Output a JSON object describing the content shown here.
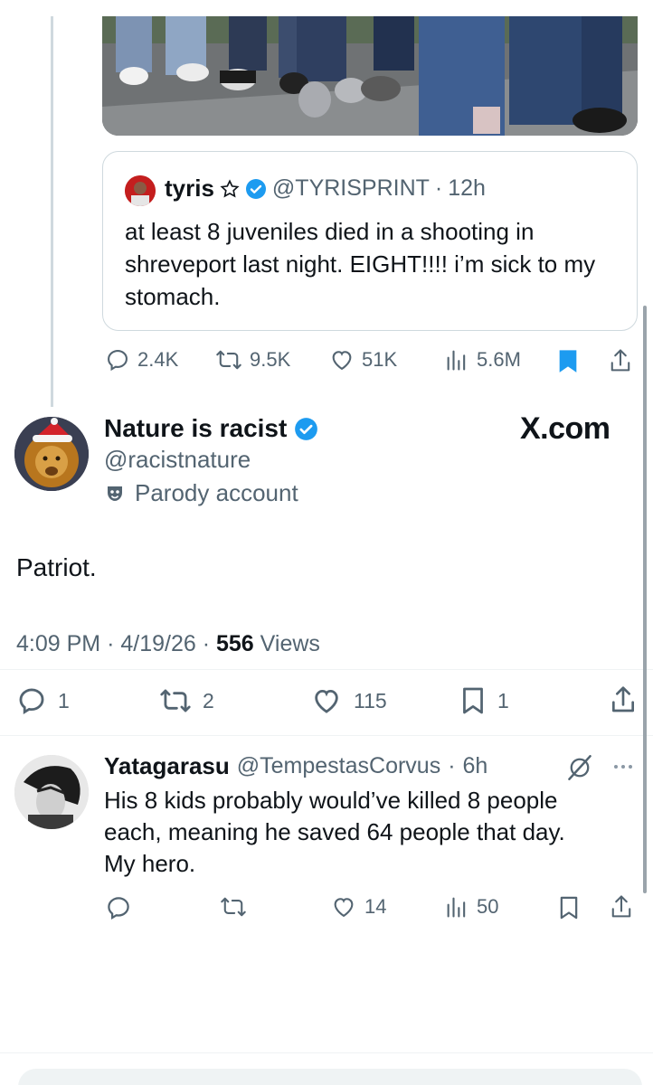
{
  "quoted": {
    "name": "tyris",
    "handle": "@TYRISPRINT",
    "time": "12h",
    "text": "at least 8 juveniles died in a shooting in shreveport last night. EIGHT!!!! i’m sick to my stomach."
  },
  "parent_actions": {
    "replies": "2.4K",
    "reposts": "9.5K",
    "likes": "51K",
    "views": "5.6M"
  },
  "main": {
    "name": "Nature is racist",
    "handle": "@racistnature",
    "label": "Parody account",
    "watermark": "X.com",
    "text": "Patriot.",
    "time": "4:09 PM",
    "date": "4/19/26",
    "views_count": "556",
    "views_label": "Views",
    "replies": "1",
    "reposts": "2",
    "likes": "115",
    "bookmarks": "1"
  },
  "reply": {
    "name": "Yatagarasu",
    "handle": "@TempestasCorvus",
    "time": "6h",
    "text_line1": "His 8 kids probably would’ve killed 8 people",
    "text_line2": "each, meaning he saved 64 people that day.",
    "text_line3": "My hero.",
    "likes": "14",
    "views": "50"
  },
  "colors": {
    "verified_blue": "#1d9bf0",
    "text_primary": "#0f1419",
    "text_secondary": "#536471",
    "border": "#cfd9de"
  }
}
